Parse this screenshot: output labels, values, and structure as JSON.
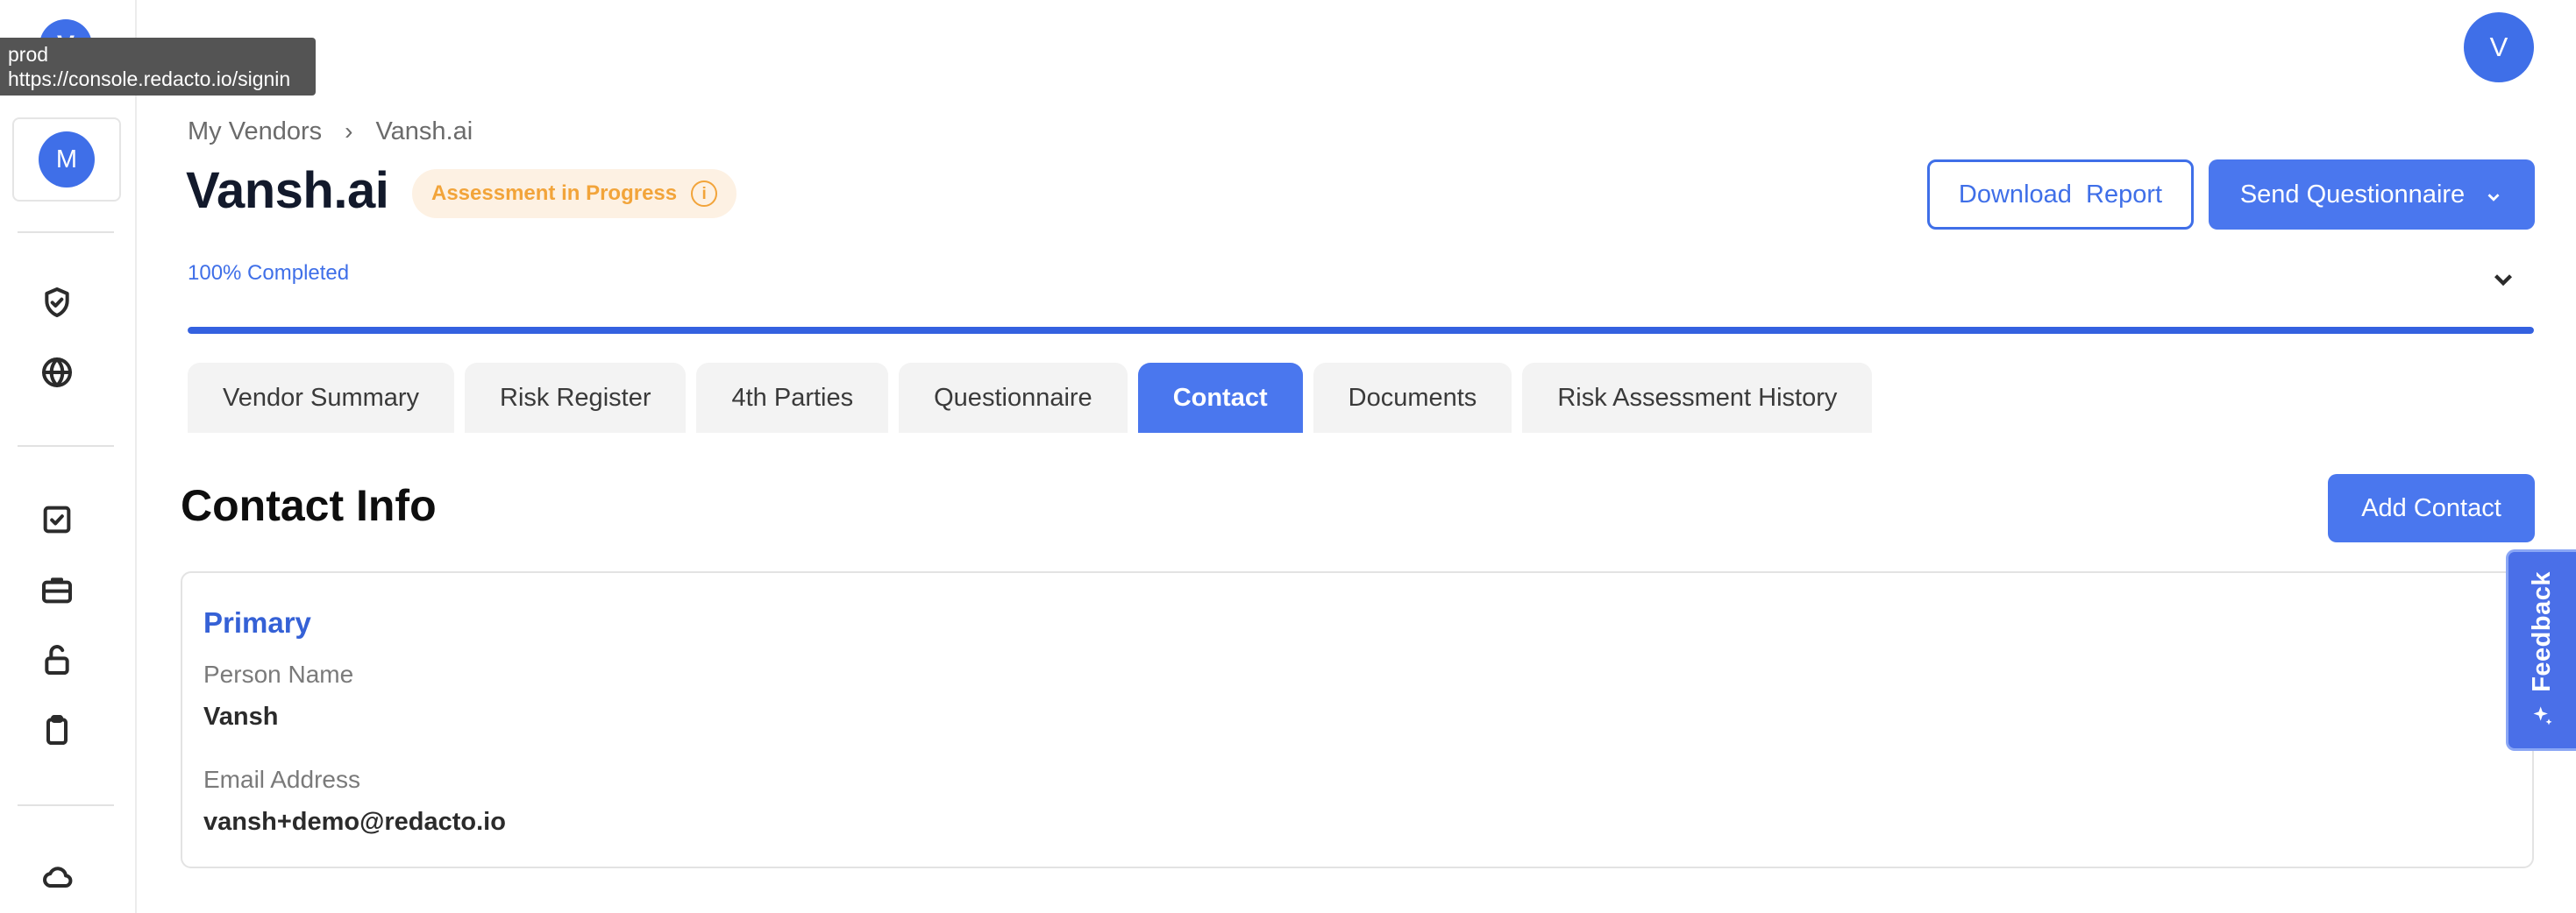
{
  "tooltip": {
    "line1": "prod",
    "line2": "https://console.redacto.io/signin"
  },
  "sidebar": {
    "logo_letter": "V",
    "workspace_initial": "M",
    "icons": [
      "shield-check-icon",
      "globe-icon",
      "checkbox-icon",
      "briefcase-icon",
      "unlock-icon",
      "clipboard-icon",
      "cloud-icon"
    ]
  },
  "user": {
    "initial": "V"
  },
  "breadcrumb": {
    "parent": "My Vendors",
    "current": "Vansh.ai"
  },
  "header": {
    "title": "Vansh.ai",
    "status": "Assessment in Progress",
    "status_color": "#f2a43a",
    "download_label": "Download  Report",
    "send_label": "Send Questionnaire",
    "accent_color": "#4a77ee"
  },
  "progress": {
    "label": "100% Completed",
    "percent": 100
  },
  "tabs": [
    {
      "label": "Vendor Summary",
      "active": false
    },
    {
      "label": "Risk Register",
      "active": false
    },
    {
      "label": "4th Parties",
      "active": false
    },
    {
      "label": "Questionnaire",
      "active": false
    },
    {
      "label": "Contact",
      "active": true
    },
    {
      "label": "Documents",
      "active": false
    },
    {
      "label": "Risk Assessment History",
      "active": false
    }
  ],
  "section": {
    "title": "Contact Info",
    "add_label": "Add Contact"
  },
  "contact": {
    "heading": "Primary",
    "name_label": "Person Name",
    "name_value": "Vansh",
    "email_label": "Email Address",
    "email_value": "vansh+demo@redacto.io"
  },
  "feedback": {
    "label": "Feedback"
  }
}
